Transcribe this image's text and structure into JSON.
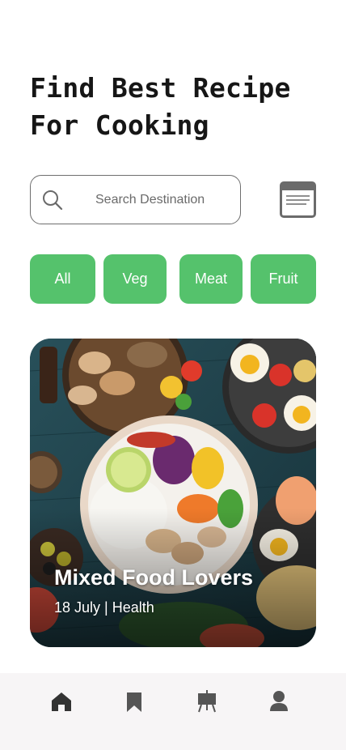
{
  "header": {
    "title_line1": "Find Best Recipe",
    "title_line2": "For Cooking"
  },
  "search": {
    "placeholder": "Search Destination",
    "icon": "search-icon"
  },
  "filter_button": {
    "icon": "filter-icon"
  },
  "categories": [
    {
      "label": "All"
    },
    {
      "label": "Veg"
    },
    {
      "label": "Meat"
    },
    {
      "label": "Fruit"
    }
  ],
  "feature_card": {
    "title": "Mixed Food Lovers",
    "meta": "18 July | Health"
  },
  "bottom_nav": {
    "items": [
      {
        "icon": "home-icon"
      },
      {
        "icon": "bookmark-icon"
      },
      {
        "icon": "easel-icon"
      },
      {
        "icon": "user-icon"
      }
    ]
  },
  "colors": {
    "accent": "#55c26c",
    "text": "#161616",
    "nav_background": "#f7f5f6",
    "icon": "#555555"
  }
}
